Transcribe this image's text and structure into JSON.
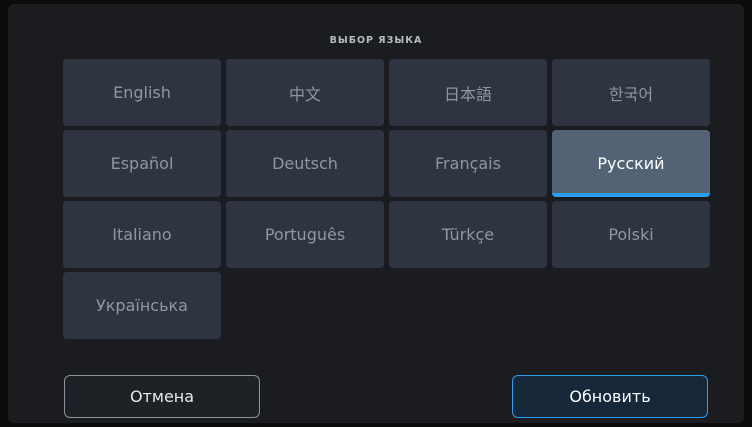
{
  "dialog": {
    "title": "ВЫБОР ЯЗЫКА"
  },
  "languages": [
    {
      "label": "English",
      "selected": false
    },
    {
      "label": "中文",
      "selected": false
    },
    {
      "label": "日本語",
      "selected": false
    },
    {
      "label": "한국어",
      "selected": false
    },
    {
      "label": "Español",
      "selected": false
    },
    {
      "label": "Deutsch",
      "selected": false
    },
    {
      "label": "Français",
      "selected": false
    },
    {
      "label": "Русский",
      "selected": true
    },
    {
      "label": "Italiano",
      "selected": false
    },
    {
      "label": "Português",
      "selected": false
    },
    {
      "label": "Türkçe",
      "selected": false
    },
    {
      "label": "Polski",
      "selected": false
    },
    {
      "label": "Українська",
      "selected": false
    }
  ],
  "buttons": {
    "cancel_label": "Отмена",
    "update_label": "Обновить"
  },
  "colors": {
    "background": "#1a1c20",
    "tile": "#2e3540",
    "tile_selected": "#546275",
    "accent": "#2a9df4"
  }
}
